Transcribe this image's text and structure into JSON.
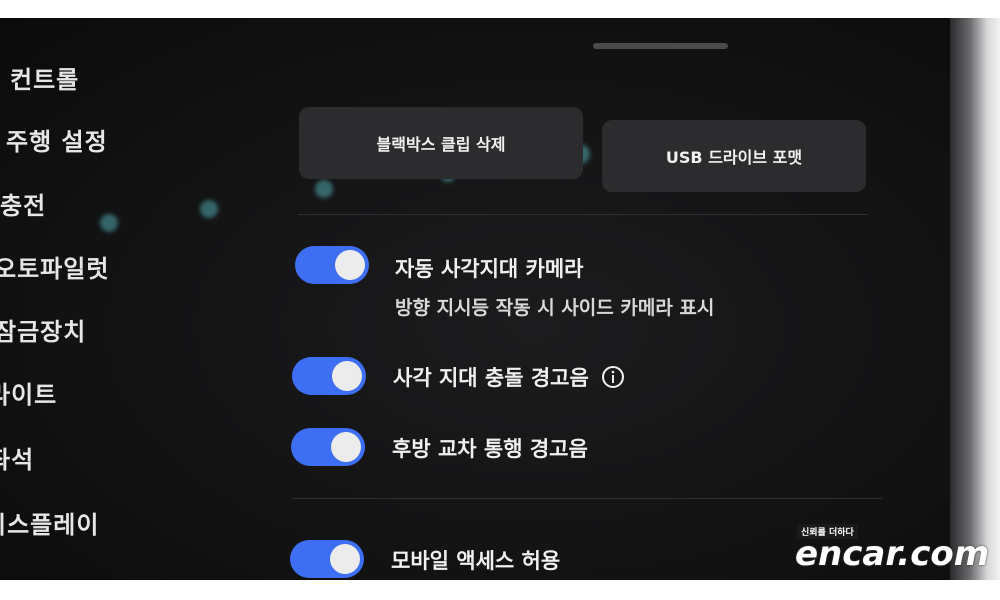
{
  "sidebar": {
    "items": [
      {
        "label": "컨트롤"
      },
      {
        "label": "주행 설정"
      },
      {
        "label": "충전"
      },
      {
        "label": "오토파일럿"
      },
      {
        "label": "잠금장치"
      },
      {
        "label": "라이트"
      },
      {
        "label": "좌석"
      },
      {
        "label": "디스플레이"
      }
    ]
  },
  "actions": {
    "dashcam_delete": "블랙박스 클립 삭제",
    "usb_format": "USB 드라이브 포맷"
  },
  "settings": [
    {
      "label": "자동 사각지대 카메라",
      "sublabel": "방향 지시등 작동 시 사이드 카메라 표시",
      "enabled": true
    },
    {
      "label": "사각 지대 충돌 경고음",
      "info_icon": "info-icon",
      "enabled": true
    },
    {
      "label": "후방 교차 통행 경고음",
      "enabled": true
    },
    {
      "label": "모바일 액세스 허용",
      "enabled": true
    }
  ],
  "watermark": {
    "tagline": "신뢰를 더하다",
    "brand": "encar.com"
  },
  "colors": {
    "toggle_on": "#3e6ff2",
    "background": "#141415",
    "button": "#2c2c2e"
  }
}
